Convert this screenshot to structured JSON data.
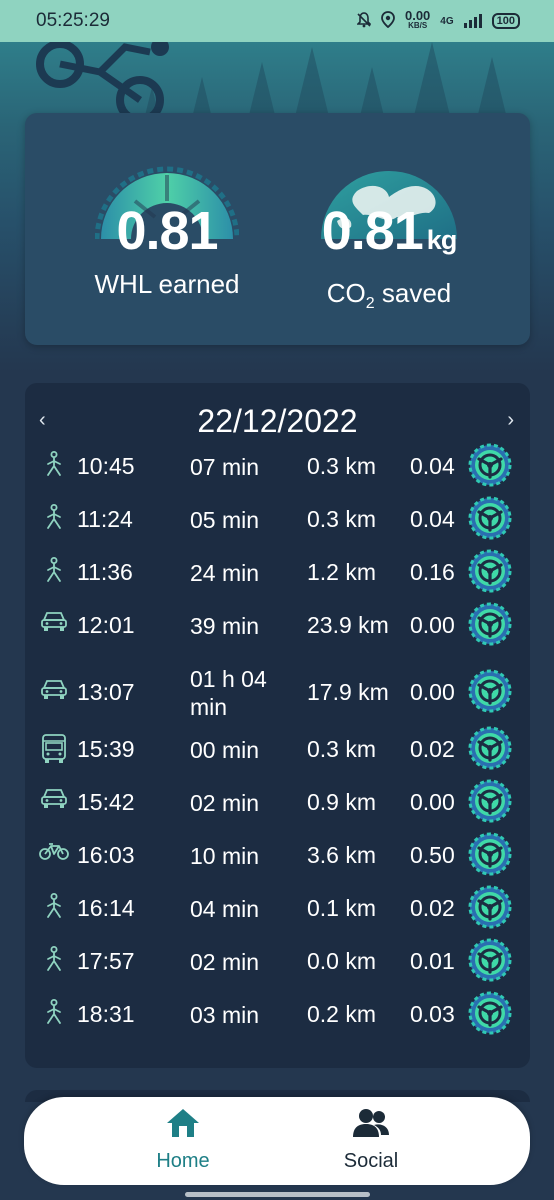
{
  "status_bar": {
    "time": "05:25:29",
    "speed_value": "0.00",
    "speed_unit": "KB/S",
    "network": "4G",
    "battery": "100"
  },
  "stats": {
    "whl_value": "0.81",
    "whl_label": "WHL earned",
    "co2_value": "0.81",
    "co2_unit": "kg",
    "co2_label_main": "CO",
    "co2_label_sub": "2",
    "co2_label_rest": " saved"
  },
  "trips": {
    "date": "22/12/2022",
    "prev_arrow": "‹",
    "next_arrow": "›",
    "rows": [
      {
        "mode": "walk",
        "time": "10:45",
        "duration": "07 min",
        "distance": "0.3 km",
        "reward": "0.04"
      },
      {
        "mode": "walk",
        "time": "11:24",
        "duration": "05 min",
        "distance": "0.3 km",
        "reward": "0.04"
      },
      {
        "mode": "walk",
        "time": "11:36",
        "duration": "24 min",
        "distance": "1.2 km",
        "reward": "0.16"
      },
      {
        "mode": "car",
        "time": "12:01",
        "duration": "39 min",
        "distance": "23.9 km",
        "reward": "0.00"
      },
      {
        "mode": "car",
        "time": "13:07",
        "duration": "01 h 04",
        "duration_line2": "min",
        "distance": "17.9 km",
        "reward": "0.00"
      },
      {
        "mode": "bus",
        "time": "15:39",
        "duration": "00 min",
        "distance": "0.3 km",
        "reward": "0.02"
      },
      {
        "mode": "car",
        "time": "15:42",
        "duration": "02 min",
        "distance": "0.9 km",
        "reward": "0.00"
      },
      {
        "mode": "bike",
        "time": "16:03",
        "duration": "10 min",
        "distance": "3.6 km",
        "reward": "0.50"
      },
      {
        "mode": "walk",
        "time": "16:14",
        "duration": "04 min",
        "distance": "0.1 km",
        "reward": "0.02"
      },
      {
        "mode": "walk",
        "time": "17:57",
        "duration": "02 min",
        "distance": "0.0 km",
        "reward": "0.01"
      },
      {
        "mode": "walk",
        "time": "18:31",
        "duration": "03 min",
        "distance": "0.2 km",
        "reward": "0.03"
      }
    ]
  },
  "nav": {
    "home_label": "Home",
    "social_label": "Social"
  },
  "colors": {
    "status_bar": "#8fd3c0",
    "accent": "#1e7f86",
    "mode_icon": "#8fd3c0",
    "card_dark": "#1c2c42"
  }
}
